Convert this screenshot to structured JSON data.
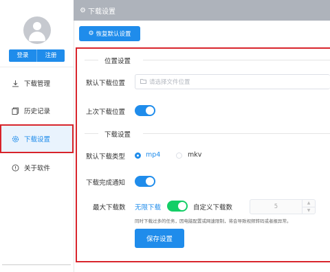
{
  "sidebar": {
    "login_label": "登录",
    "register_label": "注册",
    "items": [
      {
        "label": "下载管理",
        "icon": "download-icon"
      },
      {
        "label": "历史记录",
        "icon": "history-icon"
      },
      {
        "label": "下载设置",
        "icon": "gear-icon",
        "active": true
      },
      {
        "label": "关于软件",
        "icon": "info-icon"
      }
    ]
  },
  "header": {
    "title": "下载设置",
    "icon": "gear-icon"
  },
  "toolbar": {
    "reset_label": "恢复默认设置"
  },
  "location_section": {
    "title": "位置设置",
    "default_path_label": "默认下载位置",
    "path_placeholder": "请选择文件位置",
    "last_location_label": "上次下载位置",
    "last_location_enabled": true
  },
  "download_section": {
    "title": "下载设置",
    "type_label": "默认下载类型",
    "type_options": [
      "mp4",
      "mkv"
    ],
    "type_selected": "mp4",
    "notify_label": "下载完成通知",
    "notify_enabled": true,
    "max_label": "最大下载数",
    "unlimited_label": "无限下载",
    "custom_label": "自定义下载数",
    "custom_value": "5",
    "hint": "同时下载过多的任务，因电脑配置或网速限制，将会导致视频转码或者报异常。",
    "save_label": "保存设置"
  },
  "colors": {
    "accent": "#1f8ceb",
    "toggle_green": "#13ce66",
    "header_bg": "#aeb3bb",
    "highlight_border": "#d8232a"
  }
}
